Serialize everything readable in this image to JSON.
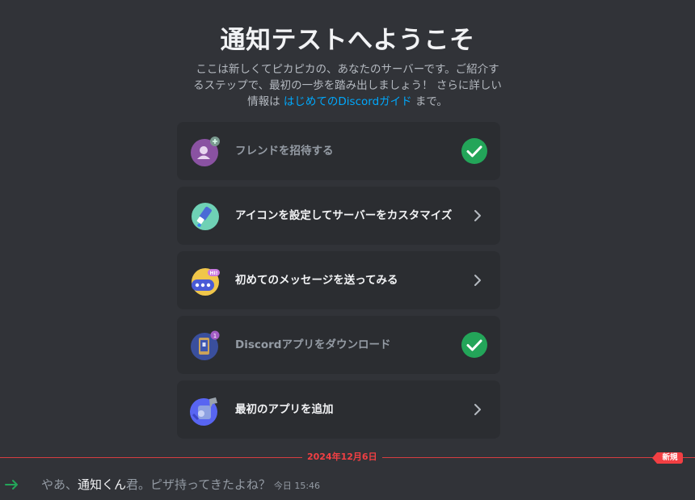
{
  "welcome": {
    "title": "通知テストへようこそ",
    "desc_line1": "ここは新しくてピカピカの、あなたのサーバーです。ご紹介す",
    "desc_line2": "るステップで、最初の一歩を踏み出しましょう！ さらに詳しい",
    "desc_line3_prefix": "情報は ",
    "guide_link": "はじめてのDiscordガイド",
    "desc_line3_suffix": " まで。"
  },
  "cards": [
    {
      "label": "フレンドを招待する",
      "icon": "invite-friend-icon",
      "status": "done"
    },
    {
      "label": "アイコンを設定してサーバーをカスタマイズ",
      "icon": "paintbrush-icon",
      "status": "todo"
    },
    {
      "label": "初めてのメッセージを送ってみる",
      "icon": "chat-bubble-icon",
      "status": "todo"
    },
    {
      "label": "Discordアプリをダウンロード",
      "icon": "mobile-app-icon",
      "status": "done"
    },
    {
      "label": "最初のアプリを追加",
      "icon": "robot-app-icon",
      "status": "todo"
    }
  ],
  "divider": {
    "date": "2024年12月6日",
    "new_badge": "新規"
  },
  "message": {
    "prefix": "やあ、",
    "username": "通知くん",
    "suffix": "君。ピザ持ってきたよね？",
    "time": "今日 15:46"
  },
  "colors": {
    "background": "#313338",
    "card": "#2b2d31",
    "accent_link": "#00a8fc",
    "check_green": "#23a559",
    "new_red": "#f23f43",
    "join_arrow": "#23a559"
  }
}
